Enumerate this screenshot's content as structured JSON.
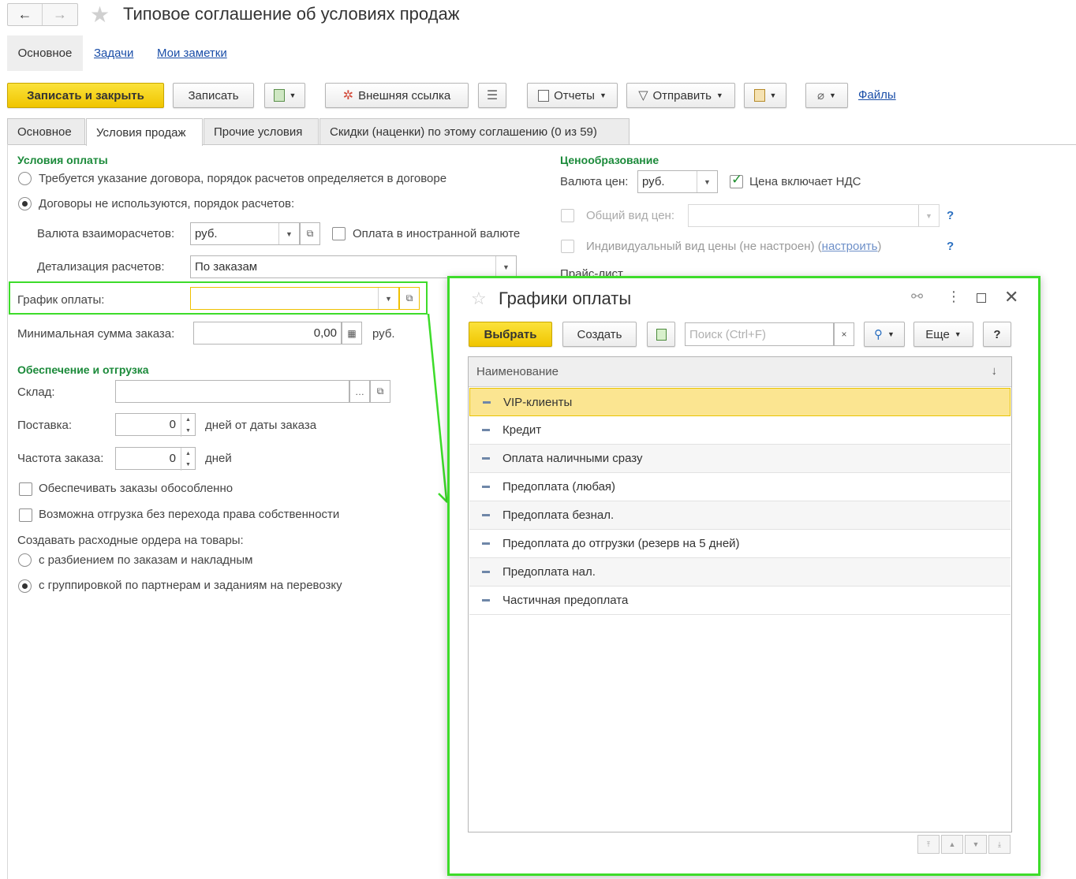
{
  "window": {
    "title": "Типовое соглашение об условиях продаж",
    "nav_back": "←",
    "nav_forward": "→"
  },
  "top_tabs": [
    "Основное",
    "Задачи",
    "Мои заметки"
  ],
  "toolbar": {
    "save_close": "Записать и закрыть",
    "save": "Записать",
    "external_link": "Внешняя ссылка",
    "reports": "Отчеты",
    "send": "Отправить",
    "files": "Файлы"
  },
  "form_tabs": [
    "Основное",
    "Условия продаж",
    "Прочие условия",
    "Скидки (наценки) по этому соглашению (0 из 59)"
  ],
  "payment": {
    "section": "Условия оплаты",
    "radio1": "Требуется указание договора, порядок расчетов определяется в договоре",
    "radio2": "Договоры не используются, порядок расчетов:",
    "currency_label": "Валюта взаиморасчетов:",
    "currency_value": "руб.",
    "foreign_label": "Оплата в иностранной валюте",
    "detail_label": "Детализация расчетов:",
    "detail_value": "По заказам",
    "schedule_label": "График оплаты:",
    "schedule_value": "",
    "min_label": "Минимальная сумма заказа:",
    "min_value": "0,00",
    "min_unit": "руб."
  },
  "shipping": {
    "section": "Обеспечение и отгрузка",
    "warehouse_label": "Склад:",
    "warehouse_value": "",
    "delivery_label": "Поставка:",
    "delivery_value": "0",
    "delivery_unit": "дней от даты заказа",
    "freq_label": "Частота заказа:",
    "freq_value": "0",
    "freq_unit": "дней",
    "cb1": "Обеспечивать заказы обособленно",
    "cb2": "Возможна отгрузка без перехода права собственности",
    "orders_label": "Создавать расходные ордера на товары:",
    "orders_r1": "с разбиением по заказам и накладным",
    "orders_r2": "с группировкой по партнерам и заданиям на перевозку"
  },
  "pricing": {
    "section": "Ценообразование",
    "currency_label": "Валюта цен:",
    "currency_value": "руб.",
    "vat_label": "Цена включает НДС",
    "general_label": "Общий вид цен:",
    "general_value": "",
    "individual_label": "Индивидуальный вид цены (не настроен) (",
    "individual_link": "настроить",
    "individual_close": ")",
    "help": "?",
    "pricelist": "Прайс-лист"
  },
  "popup": {
    "title": "Графики оплаты",
    "select": "Выбрать",
    "create": "Создать",
    "search_placeholder": "Поиск (Ctrl+F)",
    "search_clear": "×",
    "more": "Еще",
    "help": "?",
    "column": "Наименование",
    "sort": "↓",
    "items": [
      "VIP-клиенты",
      "Кредит",
      "Оплата наличными сразу",
      "Предоплата (любая)",
      "Предоплата безнал.",
      "Предоплата до отгрузки (резерв на 5 дней)",
      "Предоплата нал.",
      "Частичная предоплата"
    ]
  },
  "colors": {
    "accent_yellow": "#f5d000",
    "highlight_green": "#3ddc2a",
    "section_green": "#1b8a3a",
    "link_blue": "#1a4ea8",
    "selected_row": "#fbe591"
  }
}
